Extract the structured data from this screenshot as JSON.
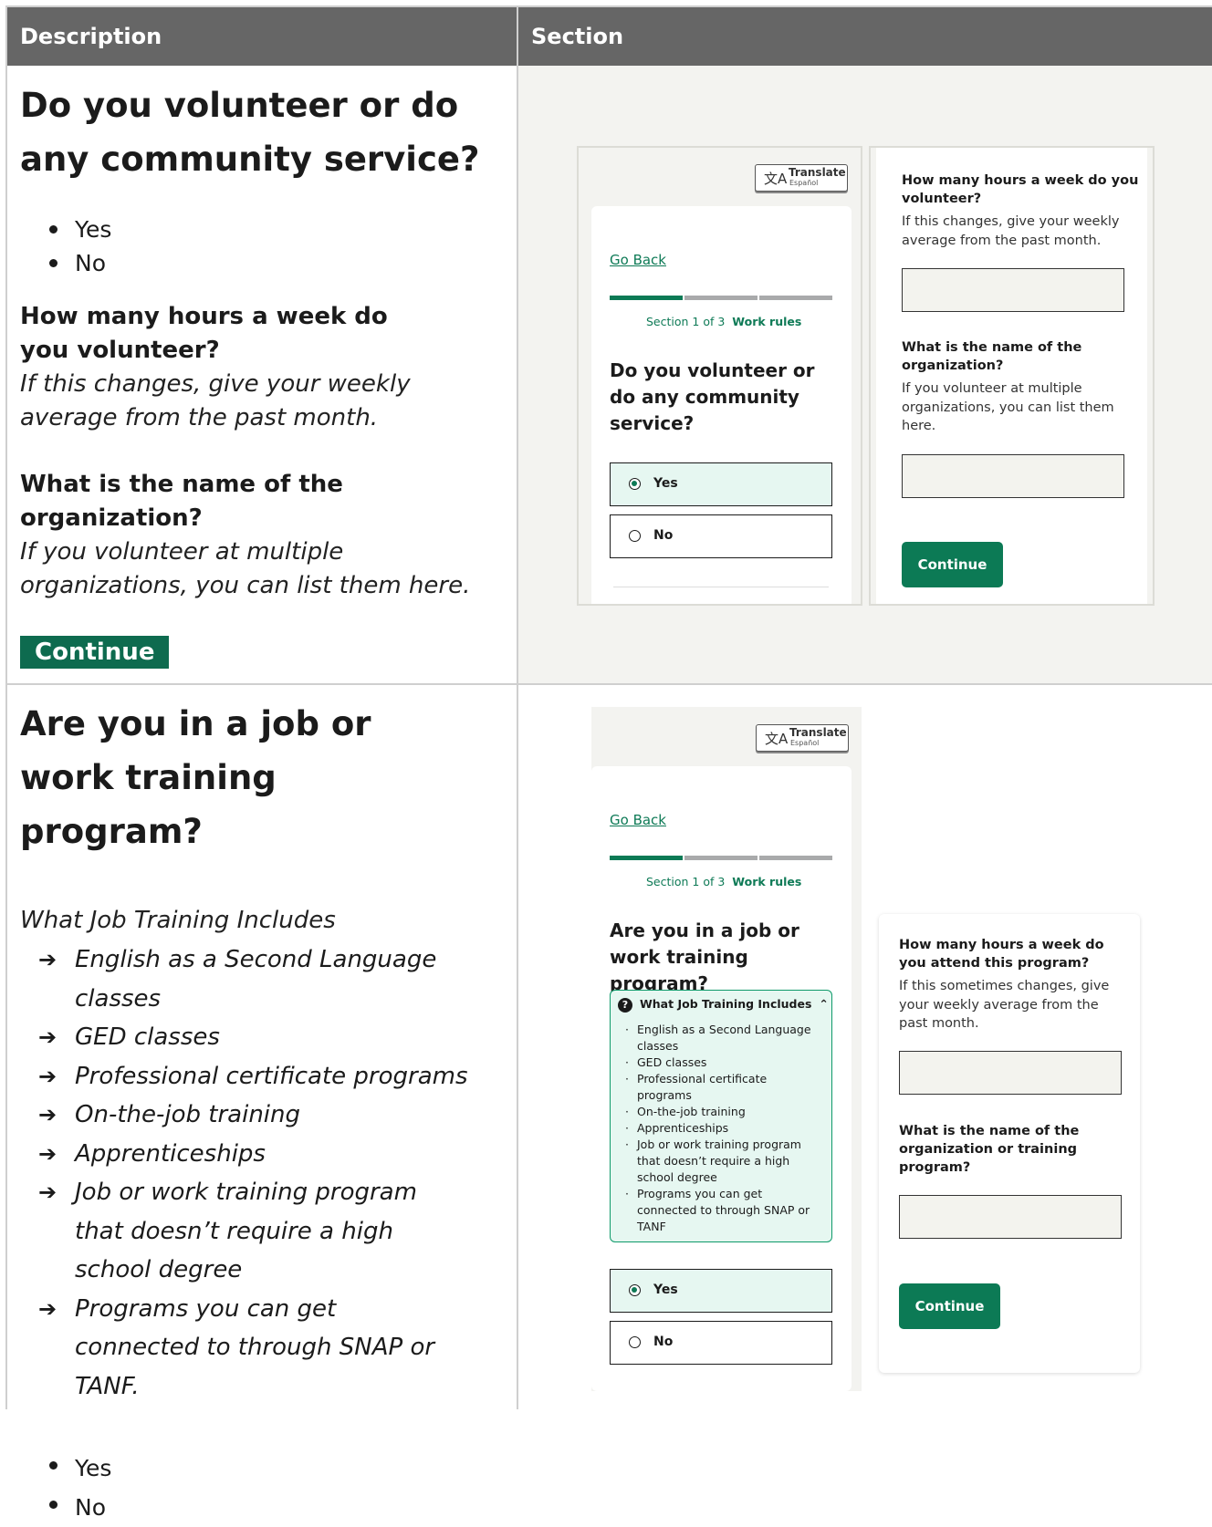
{
  "table": {
    "header_description": "Description",
    "header_section": "Section"
  },
  "row1": {
    "question": "Do you volunteer or do any community service?",
    "options": [
      "Yes",
      "No"
    ],
    "hours_q": "How many hours a week do you volunteer?",
    "hours_hint": "If this changes, give your weekly average from the past month.",
    "org_q": "What is the name of the organization?",
    "org_hint": "If you volunteer at multiple organizations, you can list them here.",
    "continue": "Continue"
  },
  "row2": {
    "question": "Are you in a job or work training program?",
    "includes_label": "What Job Training Includes",
    "includes": [
      "English as a Second Language classes",
      "GED classes",
      "Professional certificate programs",
      "On-the-job training",
      "Apprenticeships",
      "Job or work training program that doesn’t require a high school degree",
      "Programs you can get connected to through SNAP or TANF."
    ],
    "options": [
      "Yes",
      "No"
    ]
  },
  "mock1": {
    "translate": "Translate",
    "translate_sub": "Español",
    "go_back": "Go Back",
    "section_prefix": "Section 1 of 3",
    "section_name": "Work rules",
    "question": "Do you volunteer or do any community service?",
    "yes": "Yes",
    "no": "No",
    "hours_q": "How many hours a week do you volunteer?",
    "hours_hint": "If this changes, give your weekly average from the past month.",
    "org_q": "What is the name of the organization?",
    "org_hint": "If you volunteer at multiple organizations, you can list them here.",
    "continue": "Continue"
  },
  "mock2": {
    "translate": "Translate",
    "translate_sub": "Español",
    "go_back": "Go Back",
    "section_prefix": "Section 1 of 3",
    "section_name": "Work rules",
    "question": "Are you in a job or work training program?",
    "includes_label": "What Job Training Includes",
    "includes": [
      "English as a Second Language classes",
      "GED classes",
      "Professional certificate programs",
      "On-the-job training",
      "Apprenticeships",
      "Job or work training program that doesn’t require a high school degree",
      "Programs you can get connected to through SNAP or TANF"
    ],
    "yes": "Yes",
    "no": "No",
    "hours_q": "How many hours a week do you attend this program?",
    "hours_hint": "If this sometimes changes, give your weekly average from the past month.",
    "org_q": "What is the name of the organization or training program?",
    "continue": "Continue"
  },
  "colors": {
    "header_bg": "#666666",
    "accent_green": "#0c7a55",
    "doc_button": "#0e6b4f",
    "selected_bg": "#e6f7f1",
    "panel_bg": "#f3f3f0"
  },
  "icons": [
    "translate-icon",
    "question-circle-icon",
    "chevron-up-icon",
    "arrow-right-icon",
    "radio-icon"
  ]
}
